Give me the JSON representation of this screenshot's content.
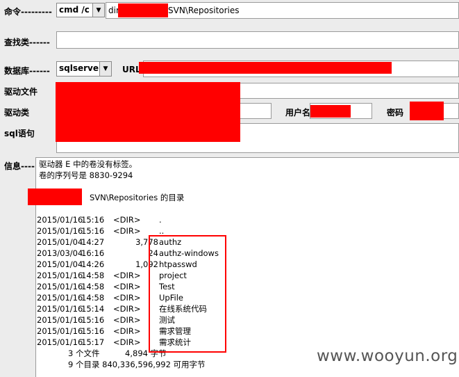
{
  "form": {
    "cmd_label": "命令---------",
    "cmd_select": "cmd /c",
    "cmd_input_prefix": "dir",
    "cmd_input_suffix": "SVN\\Repositories",
    "find_label": "查找类------",
    "find_value": "",
    "db_label": "数据库------",
    "db_select": "sqlserver",
    "url_label": "URL",
    "driver_file_label": "驱动文件",
    "driver_class_label": "驱动类",
    "user_label": "用户名",
    "password_label": "密码",
    "sql_label": "sql语句"
  },
  "info": {
    "label": "信息----",
    "header_lines": [
      "驱动器 E 中的卷没有标签。",
      "卷的序列号是 8830-9294"
    ],
    "dir_of_suffix": "SVN\\Repositories 的目录",
    "entries": [
      {
        "date": "2015/01/16",
        "time": "15:16",
        "type": "<DIR>",
        "size": "",
        "name": "."
      },
      {
        "date": "2015/01/16",
        "time": "15:16",
        "type": "<DIR>",
        "size": "",
        "name": ".."
      },
      {
        "date": "2015/01/04",
        "time": "14:27",
        "type": "",
        "size": "3,778",
        "name": "authz"
      },
      {
        "date": "2013/03/04",
        "time": "16:16",
        "type": "",
        "size": "24",
        "name": "authz-windows"
      },
      {
        "date": "2015/01/04",
        "time": "14:26",
        "type": "",
        "size": "1,092",
        "name": "htpasswd"
      },
      {
        "date": "2015/01/16",
        "time": "14:58",
        "type": "<DIR>",
        "size": "",
        "name": "project"
      },
      {
        "date": "2015/01/16",
        "time": "14:58",
        "type": "<DIR>",
        "size": "",
        "name": "Test"
      },
      {
        "date": "2015/01/16",
        "time": "14:58",
        "type": "<DIR>",
        "size": "",
        "name": "UpFile"
      },
      {
        "date": "2015/01/16",
        "time": "15:14",
        "type": "<DIR>",
        "size": "",
        "name": "在线系统代码"
      },
      {
        "date": "2015/01/16",
        "time": "15:16",
        "type": "<DIR>",
        "size": "",
        "name": "测试"
      },
      {
        "date": "2015/01/16",
        "time": "15:16",
        "type": "<DIR>",
        "size": "",
        "name": "需求管理"
      },
      {
        "date": "2015/01/16",
        "time": "15:17",
        "type": "<DIR>",
        "size": "",
        "name": "需求统计"
      }
    ],
    "summary_files": "3 个文件          4,894 字节",
    "summary_dirs": "9 个目录 840,336,596,992 可用字节"
  },
  "watermark": "www.wooyun.org",
  "colors": {
    "redaction": "#ff0000",
    "highlight_box": "#ff0000",
    "panel_bg": "#ececec"
  }
}
